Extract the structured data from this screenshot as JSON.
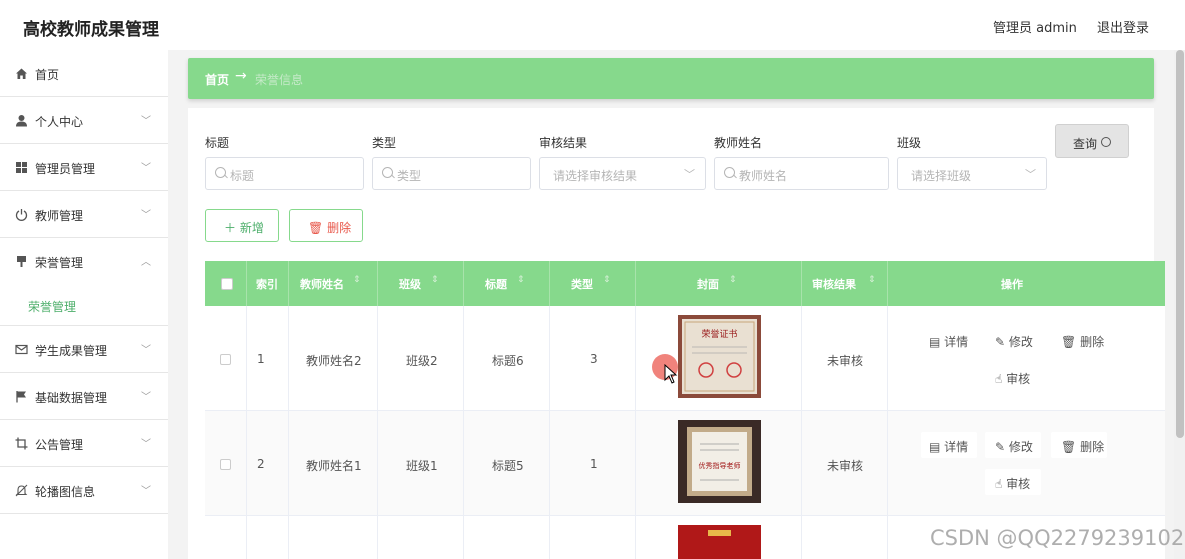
{
  "app": {
    "title": "高校教师成果管理"
  },
  "header": {
    "admin": "管理员 admin",
    "logout": "退出登录"
  },
  "sidebar": {
    "items": [
      {
        "label": "首页",
        "icon": "home-icon"
      },
      {
        "label": "个人中心",
        "icon": "user-icon"
      },
      {
        "label": "管理员管理",
        "icon": "grid-icon"
      },
      {
        "label": "教师管理",
        "icon": "power-icon"
      },
      {
        "label": "荣誉管理",
        "icon": "stamp-icon"
      },
      {
        "label": "学生成果管理",
        "icon": "mail-icon"
      },
      {
        "label": "基础数据管理",
        "icon": "flag-icon"
      },
      {
        "label": "公告管理",
        "icon": "crop-icon"
      },
      {
        "label": "轮播图信息",
        "icon": "bell-off-icon"
      }
    ],
    "active_sub": "荣誉管理"
  },
  "breadcrumb": {
    "home": "首页",
    "arrow": "→",
    "current": "荣誉信息"
  },
  "filters": {
    "title_label": "标题",
    "title_ph": "标题",
    "type_label": "类型",
    "type_ph": "类型",
    "audit_label": "审核结果",
    "audit_ph": "请选择审核结果",
    "teacher_label": "教师姓名",
    "teacher_ph": "教师姓名",
    "class_label": "班级",
    "class_ph": "请选择班级",
    "query_btn": "查询"
  },
  "actions": {
    "add": "新增",
    "delete": "删除"
  },
  "table": {
    "headers": [
      "索引",
      "教师姓名",
      "班级",
      "标题",
      "类型",
      "封面",
      "审核结果",
      "操作"
    ],
    "rows": [
      {
        "index": "1",
        "teacher": "教师姓名2",
        "class": "班级2",
        "title": "标题6",
        "type": "3",
        "audit": "未审核"
      },
      {
        "index": "2",
        "teacher": "教师姓名1",
        "class": "班级1",
        "title": "标题5",
        "type": "1",
        "audit": "未审核"
      }
    ],
    "ops": {
      "detail": "详情",
      "edit": "修改",
      "delete": "删除",
      "audit": "审核"
    }
  },
  "cover_texts": {
    "row1": "荣誉证书",
    "row2": "优秀指导老师"
  },
  "watermark": "CSDN @QQ2279239102",
  "colors": {
    "primary": "#86d98c",
    "active": "#4cae6a",
    "danger": "#e8584b",
    "warning": "#f0ad4e"
  }
}
